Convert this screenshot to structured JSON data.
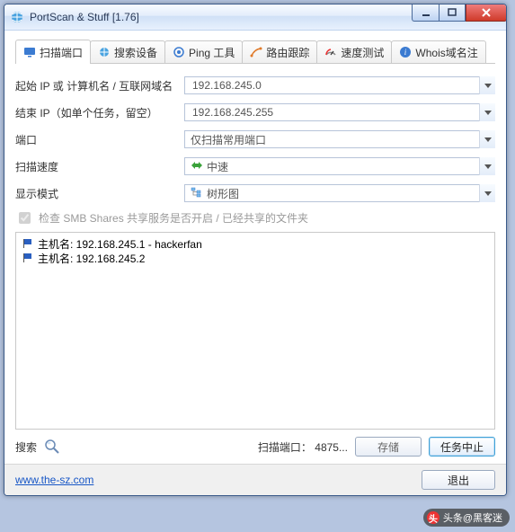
{
  "window": {
    "title": "PortScan & Stuff [1.76]"
  },
  "tabs": [
    {
      "label": "扫描端口",
      "icon": "monitor"
    },
    {
      "label": "搜索设备",
      "icon": "globe"
    },
    {
      "label": "Ping 工具",
      "icon": "ping"
    },
    {
      "label": "路由跟踪",
      "icon": "route"
    },
    {
      "label": "速度测试",
      "icon": "gauge"
    },
    {
      "label": "Whois域名注",
      "icon": "info"
    }
  ],
  "form": {
    "start_ip_label": "起始 IP 或 计算机名 / 互联网域名",
    "start_ip_value": "192.168.245.0",
    "end_ip_label": "结束 IP（如单个任务，留空）",
    "end_ip_value": "192.168.245.255",
    "port_label": "端口",
    "port_value": "仅扫描常用端口",
    "speed_label": "扫描速度",
    "speed_value": "中速",
    "display_label": "显示模式",
    "display_value": "树形图",
    "smb_checkbox_label": "检查 SMB Shares 共享服务是否开启 / 已经共享的文件夹"
  },
  "results": [
    "主机名: 192.168.245.1 - hackerfan",
    "主机名: 192.168.245.2"
  ],
  "bottom": {
    "search_label": "搜索",
    "status_label": "扫描端口：",
    "status_value": "4875...",
    "save_btn": "存储",
    "abort_btn": "任务中止"
  },
  "footer": {
    "url": "www.the-sz.com",
    "exit_btn": "退出"
  },
  "watermark": {
    "text": "头条@黑客迷"
  },
  "colors": {
    "accent_red": "#cf3a2a",
    "link_blue": "#1756c6"
  }
}
